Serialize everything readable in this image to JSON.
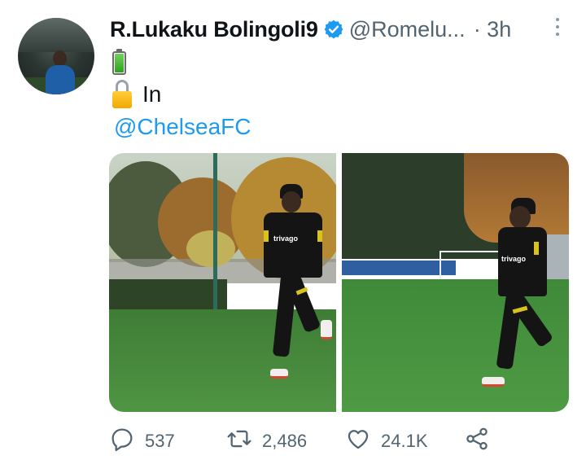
{
  "author": {
    "name": "R.Lukaku Bolingoli9",
    "handle": "@Romelu...",
    "time": "· 3h",
    "verified": true
  },
  "body": {
    "line1_emoji": "battery",
    "line2_emoji": "lock",
    "line2_text": "In",
    "mention": "@ChelseaFC"
  },
  "media": {
    "count": 2,
    "photos": [
      {
        "sponsor_text": "trivago"
      },
      {
        "sponsor_text": "trivago"
      }
    ]
  },
  "actions": {
    "reply_count": "537",
    "retweet_count": "2,486",
    "like_count": "24.1K"
  },
  "colors": {
    "link": "#1d9bf0",
    "secondary_text": "#536471",
    "verified_badge": "#1d9bf0"
  },
  "icons": {
    "reply": "reply-icon",
    "retweet": "retweet-icon",
    "like": "heart-icon",
    "share": "share-icon",
    "more": "more-vertical-icon",
    "verified": "verified-badge-icon"
  }
}
